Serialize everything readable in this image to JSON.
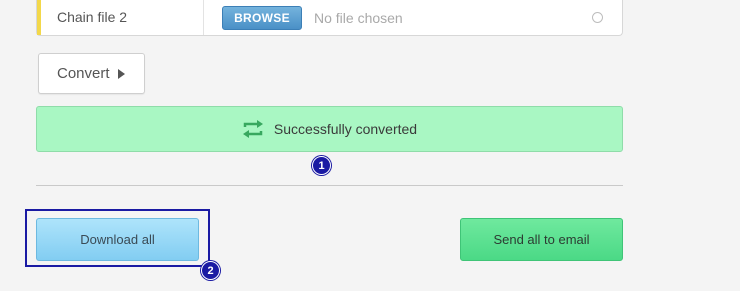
{
  "file_row": {
    "label": "Chain file 2",
    "browse_label": "BROWSE",
    "status": "No file chosen"
  },
  "convert": {
    "label": "Convert"
  },
  "success": {
    "message": "Successfully converted",
    "icon": "refresh-arrows-icon"
  },
  "badges": {
    "first": "1",
    "second": "2"
  },
  "actions": {
    "download_all": "Download all",
    "send_all_email": "Send all to email"
  },
  "colors": {
    "accent_yellow": "#f3d84a",
    "browse_blue": "#4a90c7",
    "success_green": "#a9f7c3",
    "download_blue": "#82cdf2",
    "email_green": "#4bd986",
    "annotation_blue": "#1a1aa3"
  }
}
